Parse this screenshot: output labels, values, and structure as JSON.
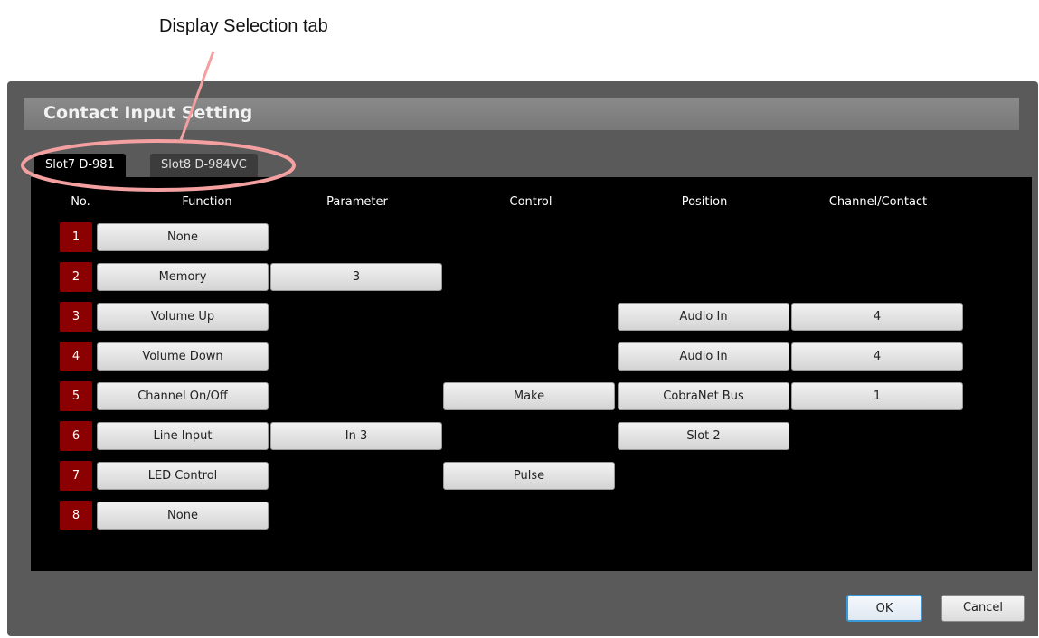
{
  "annotation": {
    "label": "Display Selection tab"
  },
  "dialog": {
    "title": "Contact Input Setting",
    "tabs": [
      {
        "label": "Slot7  D-981",
        "active": true
      },
      {
        "label": "Slot8  D-984VC",
        "active": false
      }
    ],
    "columns": [
      "No.",
      "Function",
      "Parameter",
      "Control",
      "Position",
      "Channel/Contact"
    ],
    "rows": [
      {
        "no": "1",
        "function": "None",
        "parameter": "",
        "control": "",
        "position": "",
        "channel": ""
      },
      {
        "no": "2",
        "function": "Memory",
        "parameter": "3",
        "control": "",
        "position": "",
        "channel": ""
      },
      {
        "no": "3",
        "function": "Volume Up",
        "parameter": "",
        "control": "",
        "position": "Audio In",
        "channel": "4"
      },
      {
        "no": "4",
        "function": "Volume Down",
        "parameter": "",
        "control": "",
        "position": "Audio In",
        "channel": "4"
      },
      {
        "no": "5",
        "function": "Channel On/Off",
        "parameter": "",
        "control": "Make",
        "position": "CobraNet Bus",
        "channel": "1"
      },
      {
        "no": "6",
        "function": "Line Input",
        "parameter": "In 3",
        "control": "",
        "position": "Slot 2",
        "channel": ""
      },
      {
        "no": "7",
        "function": "LED Control",
        "parameter": "",
        "control": "Pulse",
        "position": "",
        "channel": ""
      },
      {
        "no": "8",
        "function": "None",
        "parameter": "",
        "control": "",
        "position": "",
        "channel": ""
      }
    ],
    "buttons": {
      "ok": "OK",
      "cancel": "Cancel"
    }
  },
  "colors": {
    "number_badge": "#8b0000",
    "annotation": "#f4a0a0",
    "ok_border": "#3a9ad9"
  }
}
